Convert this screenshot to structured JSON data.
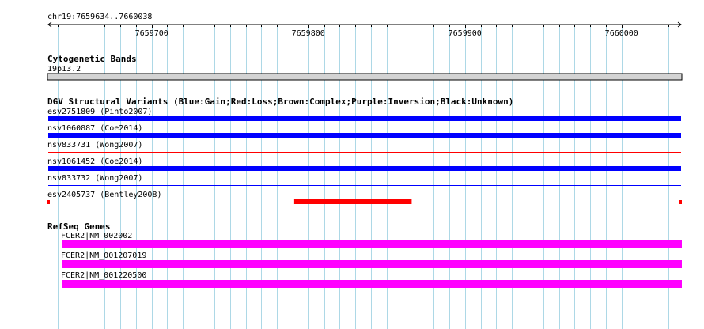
{
  "ruler": {
    "range_label": "chr19:7659634..7660038",
    "start": 7659634,
    "end": 7660038,
    "ticks": [
      "7659700",
      "7659800",
      "7659900",
      "7660000"
    ]
  },
  "colors": {
    "grid": "#add8e6",
    "gain": "#0000ff",
    "loss": "#ff0000",
    "gene": "#ff00ff",
    "band_fill": "#d3d3d3"
  },
  "tracks": {
    "cytoband": {
      "title": "Cytogenetic Bands",
      "bands": [
        {
          "label": "19p13.2"
        }
      ]
    },
    "dgv": {
      "title": "DGV Structural Variants (Blue:Gain;Red:Loss;Brown:Complex;Purple:Inversion;Black:Unknown)",
      "features": [
        {
          "label": "esv2751809 (Pinto2007)",
          "type": "gain",
          "style": "thick"
        },
        {
          "label": "nsv1060887 (Coe2014)",
          "type": "gain",
          "style": "thick"
        },
        {
          "label": "nsv833731 (Wong2007)",
          "type": "loss",
          "style": "thin"
        },
        {
          "label": "nsv1061452 (Coe2014)",
          "type": "gain",
          "style": "thick"
        },
        {
          "label": "nsv833732 (Wong2007)",
          "type": "gain",
          "style": "thin"
        },
        {
          "label": "esv2405737 (Bentley2008)",
          "type": "loss",
          "style": "partial",
          "thick_start": 7659791,
          "thick_end": 7659866
        }
      ]
    },
    "refseq": {
      "title": "RefSeq Genes",
      "genes": [
        {
          "label": "FCER2|NM_002002"
        },
        {
          "label": "FCER2|NM_001207019"
        },
        {
          "label": "FCER2|NM_001220500"
        }
      ]
    }
  }
}
